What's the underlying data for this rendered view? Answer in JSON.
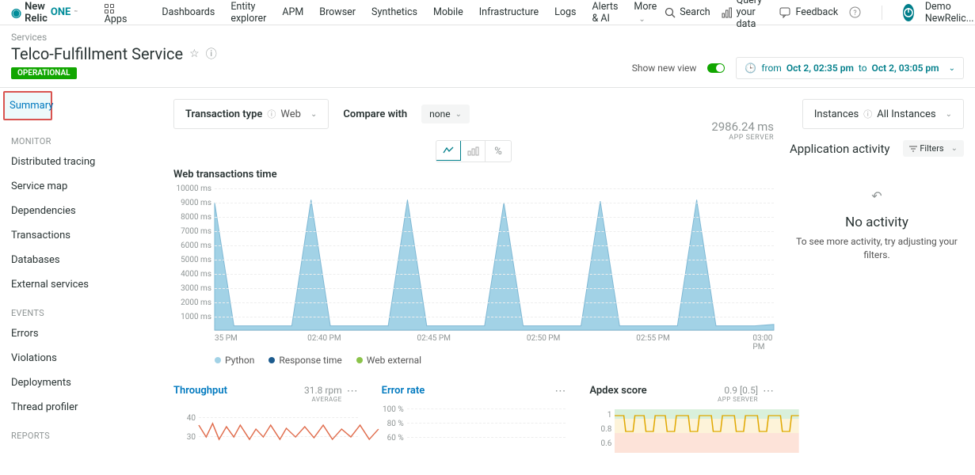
{
  "topnav": {
    "logo_text": "New Relic",
    "logo_one": "ONE",
    "apps": "Apps",
    "items": [
      "Dashboards",
      "Entity explorer",
      "APM",
      "Browser",
      "Synthetics",
      "Mobile",
      "Infrastructure",
      "Logs",
      "Alerts & AI",
      "More"
    ],
    "search": "Search",
    "query": "Query your data",
    "feedback": "Feedback",
    "user": "Demo NewRelic..."
  },
  "header": {
    "breadcrumb": "Services",
    "title": "Telco-Fulfillment Service",
    "status": "OPERATIONAL",
    "show_new_view": "Show new view",
    "time_from": "from",
    "time_start": "Oct 2, 02:35 pm",
    "time_to": "to",
    "time_end": "Oct 2, 03:05 pm"
  },
  "sidebar": {
    "summary": "Summary",
    "monitor_label": "MONITOR",
    "monitor_items": [
      "Distributed tracing",
      "Service map",
      "Dependencies",
      "Transactions",
      "Databases",
      "External services"
    ],
    "events_label": "EVENTS",
    "events_items": [
      "Errors",
      "Violations",
      "Deployments",
      "Thread profiler"
    ],
    "reports_label": "REPORTS"
  },
  "toolbar": {
    "tx_type_label": "Transaction type",
    "tx_type_value": "Web",
    "compare_label": "Compare with",
    "compare_value": "none",
    "instances_label": "Instances",
    "instances_value": "All Instances",
    "percent": "%"
  },
  "main_chart": {
    "title": "Web transactions time",
    "metric_value": "2986.24",
    "metric_unit": "ms",
    "metric_sub": "APP SERVER",
    "legend": [
      {
        "label": "Python",
        "color": "#a2d2e6"
      },
      {
        "label": "Response time",
        "color": "#1c5b8e"
      },
      {
        "label": "Web external",
        "color": "#8bc34a"
      }
    ]
  },
  "chart_data": {
    "type": "area",
    "title": "Web transactions time",
    "ylabel": "ms",
    "ylim": [
      0,
      10000
    ],
    "y_ticks": [
      10000,
      9000,
      8000,
      7000,
      6000,
      5000,
      4000,
      3000,
      2000,
      1000
    ],
    "y_tick_labels": [
      "10000 ms",
      "9000 ms",
      "8000 ms",
      "7000 ms",
      "6000 ms",
      "5000 ms",
      "4000 ms",
      "3000 ms",
      "2000 ms",
      "1000 ms"
    ],
    "x_tick_labels": [
      "35 PM",
      "02:40 PM",
      "02:45 PM",
      "02:50 PM",
      "02:55 PM",
      "03:00 PM"
    ],
    "series": [
      {
        "name": "Python",
        "color": "#a2d2e6",
        "values": [
          9000,
          300,
          300,
          300,
          300,
          9200,
          300,
          300,
          300,
          300,
          9200,
          300,
          300,
          300,
          300,
          9000,
          300,
          300,
          300,
          300,
          9100,
          300,
          300,
          300,
          300,
          9200,
          300,
          300,
          300,
          400
        ]
      }
    ]
  },
  "activity": {
    "title": "Application activity",
    "filters": "Filters",
    "no_activity": "No activity",
    "no_activity_sub": "To see more activity, try adjusting your filters."
  },
  "mini": {
    "throughput": {
      "title": "Throughput",
      "value": "31.8",
      "unit": "rpm",
      "sub": "AVERAGE",
      "y": [
        "40",
        "30"
      ]
    },
    "error_rate": {
      "title": "Error rate",
      "y": [
        "100 %",
        "80 %",
        "60 %"
      ]
    },
    "apdex": {
      "title": "Apdex score",
      "value": "0.9",
      "range": "[0.5]",
      "sub": "APP SERVER",
      "y": [
        "1",
        "0.8",
        "0.6"
      ]
    }
  }
}
